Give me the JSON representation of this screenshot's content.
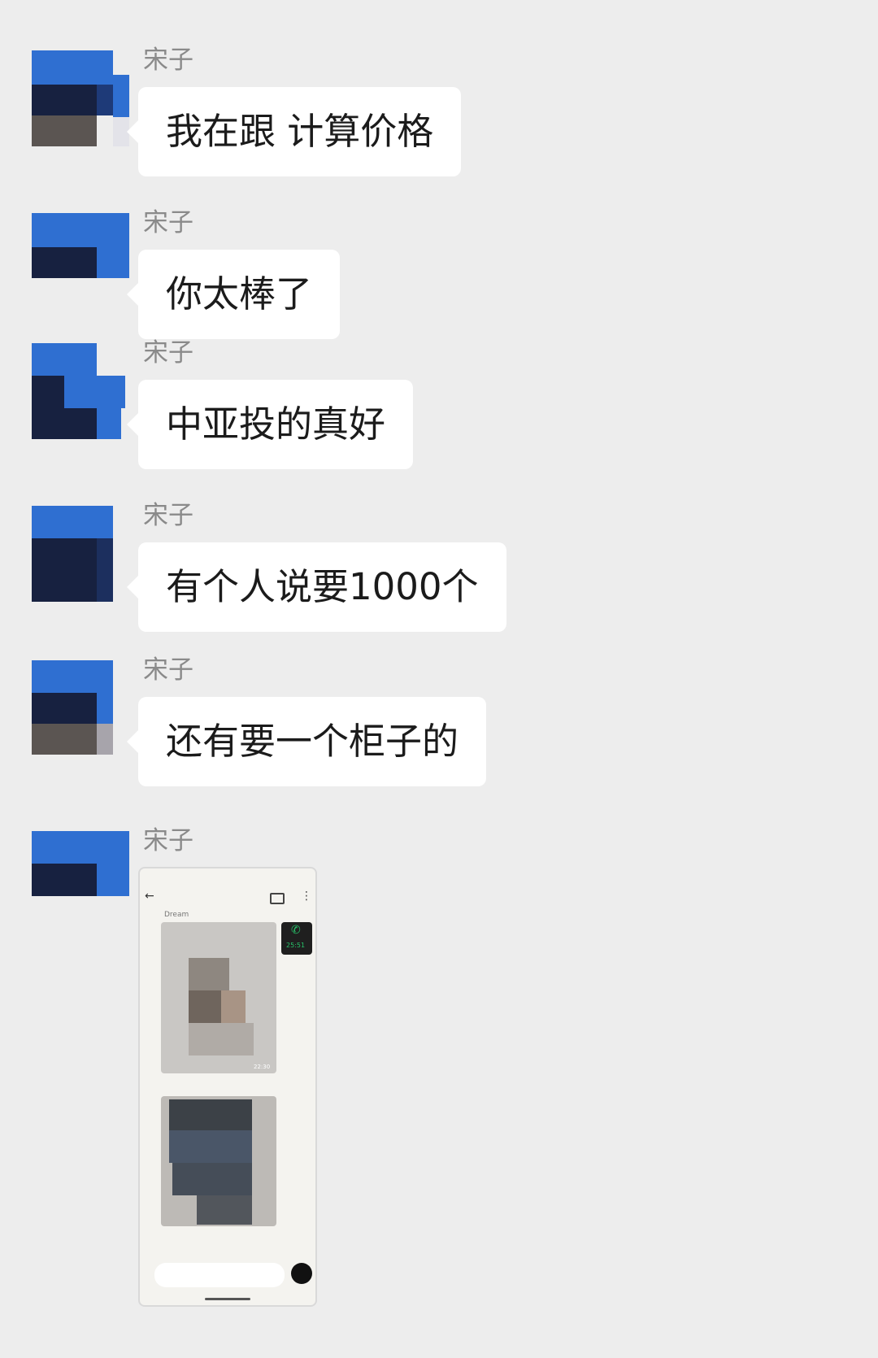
{
  "messages": [
    {
      "sender": "宋子",
      "text": "我在跟 计算价格"
    },
    {
      "sender": "宋子",
      "text": "你太棒了"
    },
    {
      "sender": "宋子",
      "text": "中亚投的真好"
    },
    {
      "sender": "宋子",
      "text": "有个人说要1000个"
    },
    {
      "sender": "宋子",
      "text": "还有要一个柜子的"
    },
    {
      "sender": "宋子",
      "image": {
        "description": "blurred phone screenshot",
        "call_time": "25:51",
        "video_time": "22:30",
        "header_label": "Dream"
      }
    }
  ],
  "colors": {
    "background": "#ededed",
    "bubble": "#ffffff",
    "sender": "#8a8a8a",
    "text": "#1b1b1b",
    "avatar_blue": "#2f6fd1",
    "avatar_navy": "#172140"
  }
}
